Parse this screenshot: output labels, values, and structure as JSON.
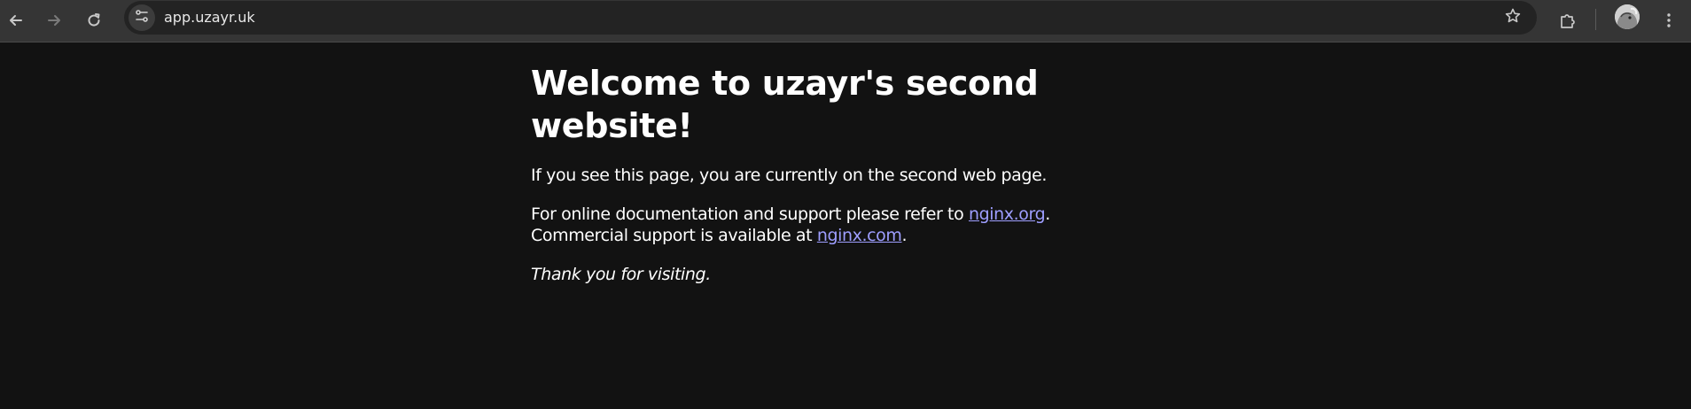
{
  "browser": {
    "url": "app.uzayr.uk",
    "icons": {
      "back": "arrow-left-icon",
      "forward": "arrow-right-icon",
      "reload": "reload-icon",
      "site_info": "tune-icon",
      "bookmark": "star-icon",
      "extensions": "puzzle-icon",
      "menu": "kebab-menu-icon"
    }
  },
  "page": {
    "heading": "Welcome to uzayr's second website!",
    "intro": "If you see this page, you are currently on the second web page.",
    "docs_prefix": "For online documentation and support please refer to ",
    "docs_link": "nginx.org",
    "docs_suffix": ".",
    "commercial_prefix": "Commercial support is available at ",
    "commercial_link": "nginx.com",
    "commercial_suffix": ".",
    "thanks": "Thank you for visiting."
  },
  "colors": {
    "page_background": "#121212",
    "toolbar_background": "#353535",
    "link": "#9e9eff",
    "text": "#ffffff"
  }
}
